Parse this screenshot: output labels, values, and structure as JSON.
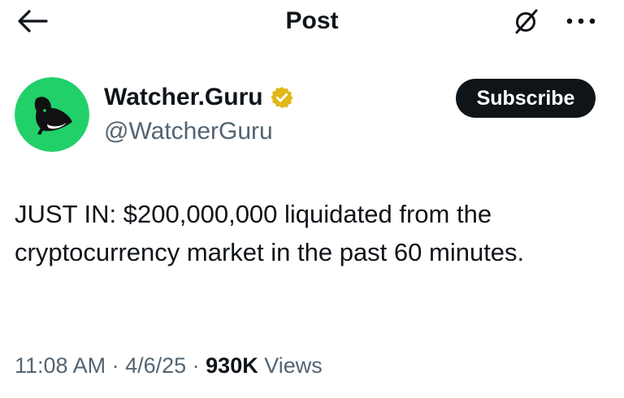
{
  "header": {
    "title": "Post",
    "back_icon": "arrow-left-icon",
    "grok_icon": "grok-icon",
    "more_icon": "more-horizontal-icon"
  },
  "author": {
    "display_name": "Watcher.Guru",
    "handle": "@WatcherGuru",
    "verified": true,
    "verified_badge_color": "#e2b719",
    "avatar_icon": "whale-logo-icon",
    "avatar_bg_color": "#22d06a"
  },
  "subscribe_label": "Subscribe",
  "tweet": {
    "text": "JUST IN: $200,000,000 liquidated from the cryptocurrency market in the past 60 minutes."
  },
  "meta": {
    "time": "11:08 AM",
    "sep1": " · ",
    "date": "4/6/25",
    "sep2": " · ",
    "views_count": "930K",
    "views_label": " Views"
  }
}
